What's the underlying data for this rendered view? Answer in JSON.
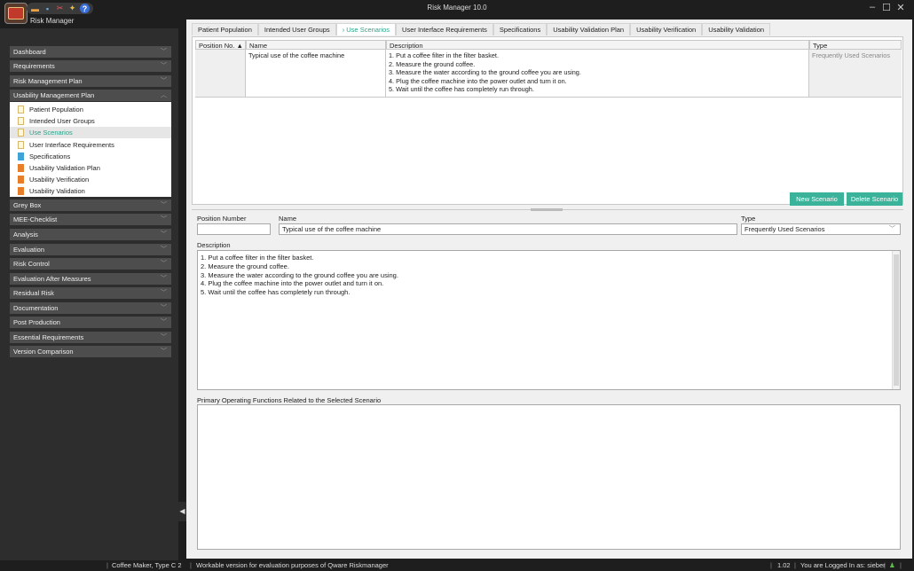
{
  "app": {
    "title": "Risk Manager   10.0",
    "name": "Risk Manager"
  },
  "window": {
    "minimize": "–",
    "maximize": "☐",
    "close": "✕"
  },
  "sidebar": {
    "sections": [
      {
        "label": "Dashboard"
      },
      {
        "label": "Requirements"
      },
      {
        "label": "Risk Management Plan"
      },
      {
        "label": "Usability Management Plan"
      },
      {
        "label": "Grey Box"
      },
      {
        "label": "MEE-Checklist"
      },
      {
        "label": "Analysis"
      },
      {
        "label": "Evaluation"
      },
      {
        "label": "Risk Control"
      },
      {
        "label": "Evaluation After Measures"
      },
      {
        "label": "Residual Risk"
      },
      {
        "label": "Documentation"
      },
      {
        "label": "Post Production"
      },
      {
        "label": "Essential Requirements"
      },
      {
        "label": "Version Comparison"
      }
    ],
    "subitems": [
      {
        "label": "Patient Population"
      },
      {
        "label": "Intended User Groups"
      },
      {
        "label": "Use Scenarios"
      },
      {
        "label": "User Interface Requirements"
      },
      {
        "label": "Specifications"
      },
      {
        "label": "Usability Validation Plan"
      },
      {
        "label": "Usability Verification"
      },
      {
        "label": "Usability Validation"
      }
    ]
  },
  "tabs": [
    {
      "label": "Patient Population"
    },
    {
      "label": "Intended User Groups"
    },
    {
      "label": "› Use Scenarios"
    },
    {
      "label": "User Interface Requirements"
    },
    {
      "label": "Specifications"
    },
    {
      "label": "Usability Validation Plan"
    },
    {
      "label": "Usability Verification"
    },
    {
      "label": "Usability Validation"
    }
  ],
  "grid": {
    "columns": [
      {
        "label": "Position No. ▲"
      },
      {
        "label": "Name"
      },
      {
        "label": "Description"
      },
      {
        "label": "Type"
      }
    ],
    "rows": [
      {
        "position": "",
        "name": "Typical use of the coffee machine",
        "description": [
          "1. Put a coffee filter in the filter basket.",
          "2. Measure the ground coffee.",
          "3. Measure the water according to the ground coffee you are using.",
          "4. Plug the coffee machine into the power outlet and turn it on.",
          "5. Wait until the coffee has completely run through."
        ],
        "type": "Frequently Used Scenarios"
      }
    ]
  },
  "buttons": {
    "new_scenario": "New Scenario",
    "delete_scenario": "Delete Scenario"
  },
  "form": {
    "position_label": "Position Number",
    "position_value": "",
    "name_label": "Name",
    "name_value": "Typical use of the coffee machine",
    "type_label": "Type",
    "type_value": "Frequently Used Scenarios",
    "description_label": "Description",
    "description_lines": [
      "1. Put a coffee filter in the filter basket.",
      "2. Measure the ground coffee.",
      "3. Measure the water according to the ground coffee you are using.",
      "4. Plug the coffee machine into the power outlet and turn it on.",
      "5. Wait until the coffee has completely run through."
    ],
    "pof_label": "Primary Operating Functions Related to the Selected Scenario"
  },
  "status": {
    "project": "Coffee Maker, Type C 2",
    "message": "Workable version for evaluation purposes of Qware Riskmanager",
    "version": "1.02",
    "login": "You are Logged In as: sieber"
  }
}
